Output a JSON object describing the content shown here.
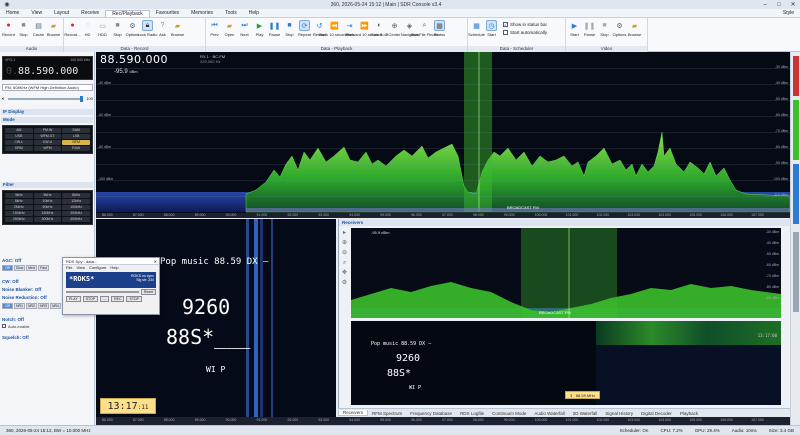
{
  "window": {
    "title": "360, 2026-05-24 15:12 | Main | SDR Console v3.4",
    "style_label": "Style"
  },
  "menu": [
    "Home",
    "View",
    "Layout",
    "Receive",
    "Rec/Playback",
    "Favourites",
    "Memories",
    "Tools",
    "Help"
  ],
  "ribbon": {
    "audio": {
      "label": "Audio",
      "buttons": [
        "Record",
        "Stop",
        "Cache",
        "Browse"
      ]
    },
    "data_record": {
      "label": "Data - Record",
      "buttons": [
        "Record...",
        "HD",
        "HDD",
        "Stop",
        "Options",
        "Lock Radio",
        "Ask",
        "Browse"
      ]
    },
    "data_playback": {
      "label": "Data - Playback",
      "buttons": [
        "Prev",
        "Open",
        "Next",
        "Play",
        "Pause",
        "Stop",
        "Repeat",
        "Restart",
        "Back 10 seconds",
        "Seek",
        "Forward 10 seconds",
        "Gain 0 dB",
        "Center",
        "Navigator",
        "DataFile Finder",
        "Status"
      ]
    },
    "data_scheduler": {
      "label": "Data - Scheduler",
      "buttons": [
        "Schedule",
        "Start"
      ],
      "checks": [
        "Show in status bar",
        "Start automatically"
      ]
    },
    "video": {
      "label": "Video",
      "buttons": [
        "Start",
        "Pause",
        "Stop",
        "Options",
        "Browse"
      ]
    }
  },
  "left": {
    "vfo_top": "VFO-1",
    "vfo_right": "100.500 kHz",
    "vfo_dim": "0.",
    "vfo_freq": "88.590.000",
    "vfo_mode": "FM, 508KHz (WFM High Definition Audio)",
    "vol_value": "100",
    "if_display": "IF Display",
    "mode_section": "Mode",
    "modes": [
      "AM",
      "FM-W",
      "SAM",
      "USB",
      "WFM-ST",
      "LSB",
      "CW-L",
      "CW-U",
      "NFM",
      "DRM",
      "WFM",
      "RAW"
    ],
    "selected_mode": "NFM",
    "filter_section": "Filter",
    "filters": [
      "3kHz",
      "5kHz",
      "6kHz",
      "8kHz",
      "10kHz",
      "12kHz",
      "25kHz",
      "50kHz",
      "100kHz",
      "150kHz",
      "180kHz",
      "200kHz",
      "250kHz",
      "300kHz",
      "400kHz"
    ],
    "agc": "AGC: Off",
    "agc_opts": [
      "Off",
      "Slow",
      "Med",
      "Fast"
    ],
    "cw": "CW: Off",
    "noise_blanker": "Noise Blanker: Off",
    "noise_reduction": "Noise Reduction: Off",
    "nr_opts": [
      "Off",
      "NR1",
      "NR2",
      "NR3",
      "NR4"
    ],
    "notch": "Notch: Off",
    "auto_enable": "Auto-enable",
    "squelch": "Squelch: Off"
  },
  "spectrum": {
    "freq": "88.590.000",
    "level": "-95.9",
    "level_unit": "dBm",
    "mode_tag": "RX 1 · BC-FM",
    "mode_sub": "225.000 Hz",
    "band_label": "BROADCAST FM",
    "db_labels": [
      "-30 dBm",
      "-40 dBm",
      "-50 dBm",
      "-60 dBm",
      "-70 dBm",
      "-80 dBm",
      "-90 dBm",
      "-100 dBm",
      "-110 dBm",
      "-120 dBm"
    ],
    "ticks": [
      "86.000",
      "87.000",
      "88.000",
      "89.000",
      "90.000",
      "91.000",
      "92.000",
      "93.000",
      "94.000",
      "95.000",
      "96.000",
      "97.000",
      "98.000",
      "99.000",
      "100.000",
      "101.000",
      "102.000",
      "103.000",
      "104.000",
      "105.000",
      "106.000",
      "107.000"
    ]
  },
  "waterfall": {
    "rds_line": "Pop music  88.59  DX  —",
    "ps_big": "9260",
    "rt_big": "88S*",
    "rt_tail": "___",
    "flags": "WI   P",
    "clock_main": "13:17",
    "clock_sec": ":11"
  },
  "rds_dialog": {
    "title": "RDS Spy - data...",
    "menu": [
      "File",
      "View",
      "Configure",
      "Help"
    ],
    "ps": "*ROKS*",
    "info_line1": "ROKS  no sync",
    "info_line2": "Sig str: 234",
    "reset_label": "Reset",
    "ctrl_buttons": [
      "PLAY",
      "STOP",
      "...",
      "REC",
      "STOP"
    ]
  },
  "receivers": {
    "title": "Receivers",
    "level": "-95.9 dBm",
    "band_label": "BROADCAST FM",
    "rds_line": "Pop music  88.59  DX  —",
    "ps": "9260",
    "rt": "88S*",
    "flags": "WI   P",
    "tooltip": "3 · 88.59 MHz",
    "wf_time": "13:17:00",
    "db_labels": [
      "-30 dBm",
      "-40 dBm",
      "-50 dBm",
      "-60 dBm",
      "-70 dBm",
      "-80 dBm",
      "-90 dBm",
      "-100 dBm"
    ]
  },
  "tabs": [
    "Receivers",
    "RFM Spectrum",
    "Frequency Database",
    "RDS Logfile",
    "Continuum Mode",
    "Audio Waterfall",
    "2D Waterfall",
    "Signal History",
    "Digital Decoder",
    "Playback"
  ],
  "status": {
    "left": "360, 2026-05-24 15:12, BW = 10.000 MHz",
    "scheduler": "Scheduler: On",
    "cpu": "CPU: 7.2%",
    "gpu": "GPU: 29.4%",
    "audio": "Audio: 10ms",
    "size": "Size: 3.4 GB"
  },
  "colors": {
    "spectrum_green": "#3bbf2a",
    "highlight": "#4dd24d",
    "vfo_bg": "#0a0c10",
    "accent": "#1c4f9c"
  }
}
